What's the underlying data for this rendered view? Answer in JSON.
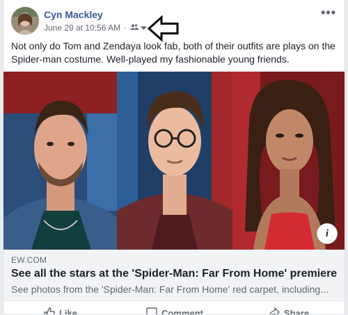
{
  "post": {
    "author": "Cyn Mackley",
    "date": "June 29 at 10:56 AM",
    "separator": "·",
    "audience_icon": "friends-icon",
    "text": "Not only do Tom and Zendaya look fab, both of their outfits are plays on the Spider-man costume. Well-played my fashionable young friends."
  },
  "link_preview": {
    "domain": "EW.COM",
    "headline": "See all the stars at the 'Spider-Man: Far From Home' premiere",
    "description": "See photos from the 'Spider-Man: Far From Home' red carpet, including..."
  },
  "actions": {
    "like": "Like",
    "comment": "Comment",
    "share": "Share"
  },
  "colors": {
    "author_link": "#385898",
    "secondary_text": "#606770",
    "link_box_bg": "#f2f3f5"
  }
}
